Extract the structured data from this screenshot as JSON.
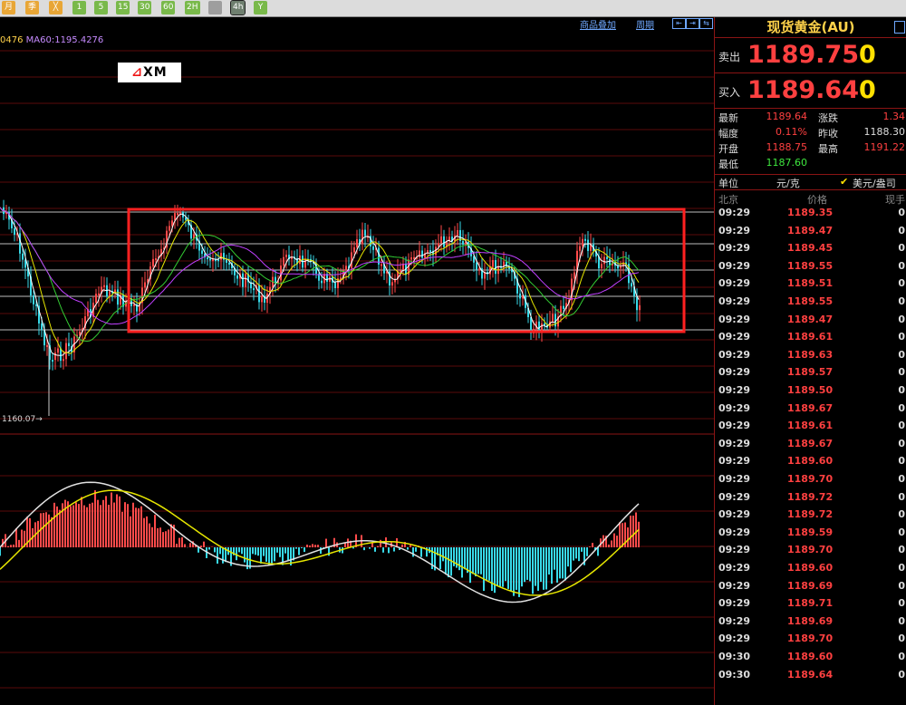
{
  "toolbar": {
    "buttons": [
      "月",
      "季",
      "╳",
      "1",
      "5",
      "15",
      "30",
      "60",
      "2H",
      "4h",
      "Y"
    ]
  },
  "chart": {
    "ma_legend_a": "0476",
    "ma_legend_b": "MA60:1195.4276",
    "overlay_link": "商品叠加",
    "period_link": "周期",
    "low_label": "1160.07→",
    "logo_text": "XM",
    "colors": {
      "up": "#ff4a4a",
      "down": "#38d9e8",
      "ma_fast": "#ffffff",
      "ma_mid": "#e6e600",
      "ma_slow": "#33cc33",
      "ma_long": "#c040ff",
      "box": "#ff2020",
      "grid": "#5a0a0a"
    }
  },
  "panel": {
    "title": "现货黄金(AU)",
    "sell_label": "卖出",
    "sell_price": "1189.75",
    "sell_suffix": "0",
    "buy_label": "买入",
    "buy_price": "1189.64",
    "buy_suffix": "0",
    "stats": {
      "latest_label": "最新",
      "latest": "1189.64",
      "change_label": "涨跌",
      "change": "1.34",
      "range_label": "幅度",
      "range": "0.11%",
      "prev_label": "昨收",
      "prev": "1188.30",
      "open_label": "开盘",
      "open": "1188.75",
      "high_label": "最高",
      "high": "1191.22",
      "low_label": "最低",
      "low": "1187.60"
    },
    "unit_label": "单位",
    "unit_value": "元/克",
    "currency": "美元/盎司",
    "col_time": "北京",
    "col_price": "价格",
    "col_qty": "现手",
    "ticks": [
      [
        "09:29",
        "1189.35",
        "0"
      ],
      [
        "09:29",
        "1189.47",
        "0"
      ],
      [
        "09:29",
        "1189.45",
        "0"
      ],
      [
        "09:29",
        "1189.55",
        "0"
      ],
      [
        "09:29",
        "1189.51",
        "0"
      ],
      [
        "09:29",
        "1189.55",
        "0"
      ],
      [
        "09:29",
        "1189.47",
        "0"
      ],
      [
        "09:29",
        "1189.61",
        "0"
      ],
      [
        "09:29",
        "1189.63",
        "0"
      ],
      [
        "09:29",
        "1189.57",
        "0"
      ],
      [
        "09:29",
        "1189.50",
        "0"
      ],
      [
        "09:29",
        "1189.67",
        "0"
      ],
      [
        "09:29",
        "1189.61",
        "0"
      ],
      [
        "09:29",
        "1189.67",
        "0"
      ],
      [
        "09:29",
        "1189.60",
        "0"
      ],
      [
        "09:29",
        "1189.70",
        "0"
      ],
      [
        "09:29",
        "1189.72",
        "0"
      ],
      [
        "09:29",
        "1189.72",
        "0"
      ],
      [
        "09:29",
        "1189.59",
        "0"
      ],
      [
        "09:29",
        "1189.70",
        "0"
      ],
      [
        "09:29",
        "1189.60",
        "0"
      ],
      [
        "09:29",
        "1189.69",
        "0"
      ],
      [
        "09:29",
        "1189.71",
        "0"
      ],
      [
        "09:29",
        "1189.69",
        "0"
      ],
      [
        "09:29",
        "1189.70",
        "0"
      ],
      [
        "09:30",
        "1189.60",
        "0"
      ],
      [
        "09:30",
        "1189.64",
        "0"
      ]
    ]
  }
}
